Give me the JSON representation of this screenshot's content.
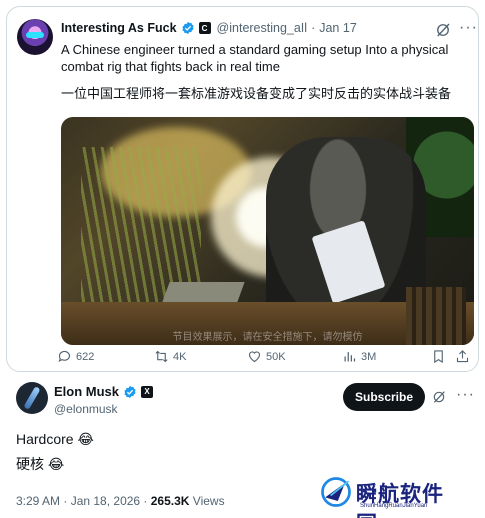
{
  "quoted_tweet": {
    "display_name": "Interesting As Fuck",
    "affiliate_badge": "C",
    "handle": "@interesting_aIl",
    "separator": "·",
    "date": "Jan 17",
    "text_en": "A Chinese engineer turned a standard gaming setup Into a physical combat rig that fights back in real time",
    "text_cn": "一位中国工程师将一套标准游戏设备变成了实时反击的实体战斗装备",
    "media": {
      "caption": "节目效果展示，请在安全措施下，请勿模仿"
    },
    "actions": {
      "replies": "622",
      "reposts": "4K",
      "likes": "50K",
      "views": "3M"
    }
  },
  "post": {
    "display_name": "Elon Musk",
    "affiliate_badge": "X",
    "handle": "@elonmusk",
    "subscribe_label": "Subscribe",
    "text": "Hardcore 😂",
    "text_cn": "硬核 😂",
    "time": "3:29 AM · Jan 18, 2026 · ",
    "views_count": "265.3K",
    "views_label": " Views"
  },
  "watermark": {
    "title": "瞬航软件园",
    "subtitle": "ShunHangRuanJianYuan"
  },
  "colors": {
    "text": "#0f1419",
    "muted": "#536471",
    "border": "#cfd9de",
    "verified": "#1d9bf0",
    "button": "#0f1419"
  }
}
